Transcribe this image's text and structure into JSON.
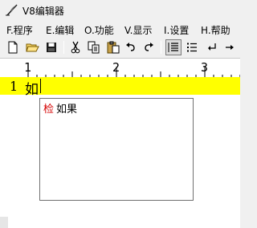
{
  "window": {
    "title": "V8编辑器",
    "icon": "feather-pen-icon"
  },
  "menubar": {
    "items": [
      {
        "label": "F.程序"
      },
      {
        "label": "E.编辑"
      },
      {
        "label": "O.功能"
      },
      {
        "label": "V.显示"
      },
      {
        "label": "I.设置"
      },
      {
        "label": "H.帮助"
      }
    ]
  },
  "toolbar": {
    "buttons": [
      "new-file-icon",
      "open-folder-icon",
      "save-icon",
      "cut-icon",
      "copy-icon",
      "paste-icon",
      "undo-icon",
      "redo-icon",
      "numbered-list-icon",
      "bullet-list-icon",
      "return-arrow-icon",
      "more-icon"
    ],
    "pressed": [
      "numbered-list-icon"
    ]
  },
  "ruler": {
    "labels": [
      "1",
      "2",
      "3"
    ]
  },
  "editor": {
    "current_line": {
      "number": "1",
      "text": "如"
    },
    "highlight_color": "#ffff00"
  },
  "autocomplete": {
    "items": [
      {
        "tag": "检",
        "word": "如果"
      }
    ],
    "tag_color": "#d40000"
  }
}
